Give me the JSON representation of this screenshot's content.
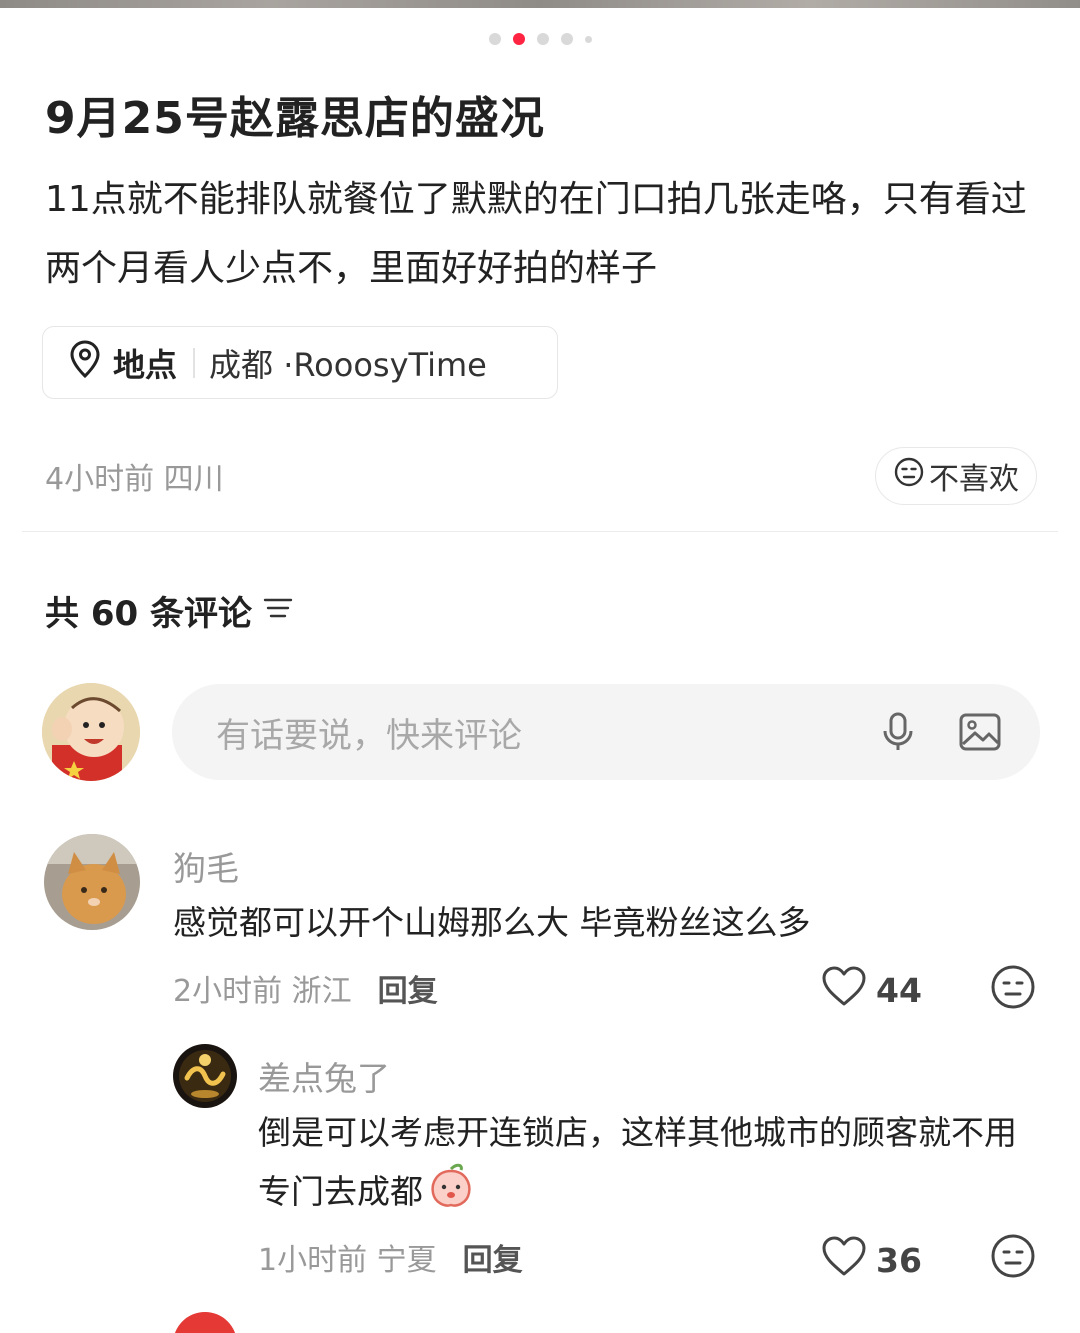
{
  "post": {
    "carousel_total": 5,
    "carousel_active": 2,
    "title": "9月25号赵露思店的盛况",
    "description": "11点就不能排队就餐位了默默的在门口拍几张走咯，只有看过两个月看人少点不，里面好好拍的样子",
    "location": {
      "icon": "location-pin-icon",
      "label": "地点",
      "city": "成都 ·RooosyTime"
    },
    "meta": "4小时前 四川",
    "dislike_label": "不喜欢"
  },
  "comments_header": {
    "count_label": "共 60 条评论",
    "sort_icon": "sort-lines-icon"
  },
  "input": {
    "placeholder": "有话要说，快来评论",
    "voice_icon": "microphone-icon",
    "image_icon": "image-icon"
  },
  "comments": [
    {
      "name": "狗毛",
      "text": "感觉都可以开个山姆那么大 毕竟粉丝这么多",
      "meta": "2小时前 浙江",
      "reply_label": "回复",
      "likes": "44"
    },
    {
      "name": "差点兔了",
      "text": "倒是可以考虑开连锁店，这样其他城市的顾客就不用专门去成都",
      "emoji": "peach-emoji",
      "meta": "1小时前 宁夏",
      "reply_label": "回复",
      "likes": "36"
    }
  ],
  "colors": {
    "accent": "#ff2442",
    "muted_text": "#999999",
    "input_bg": "#f4f4f5"
  }
}
